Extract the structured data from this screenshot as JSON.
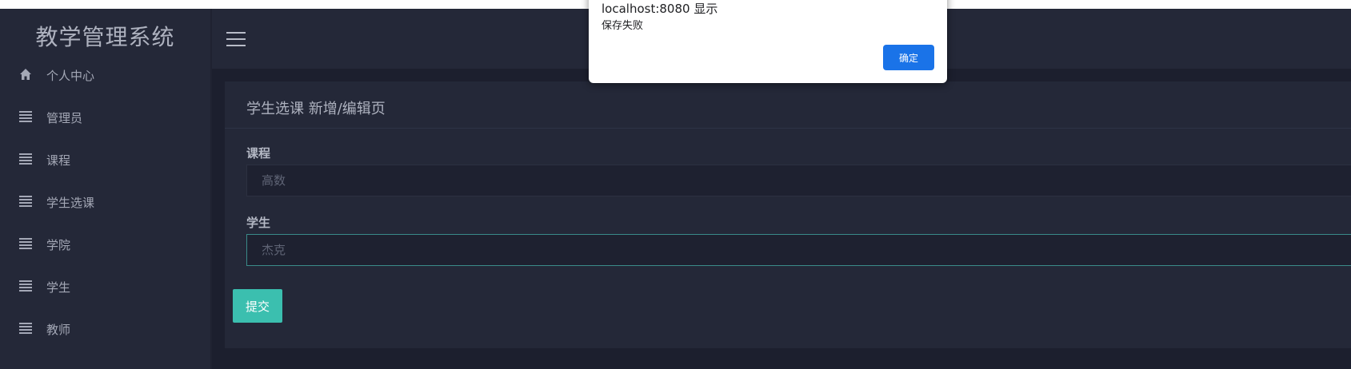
{
  "app_title": "教学管理系统",
  "menu": [
    {
      "label": "个人中心",
      "icon": "home-icon"
    },
    {
      "label": "管理员",
      "icon": "list-icon"
    },
    {
      "label": "课程",
      "icon": "list-icon"
    },
    {
      "label": "学生选课",
      "icon": "list-icon"
    },
    {
      "label": "学院",
      "icon": "list-icon"
    },
    {
      "label": "学生",
      "icon": "list-icon"
    },
    {
      "label": "教师",
      "icon": "list-icon"
    }
  ],
  "topbar": {
    "menu_icon": "hamburger-icon"
  },
  "panel": {
    "title": "学生选课 新增/编辑页",
    "fields": [
      {
        "label": "课程",
        "value": "高数"
      },
      {
        "label": "学生",
        "value": "杰克"
      }
    ],
    "submit_label": "提交"
  },
  "dialog": {
    "title": "localhost:8080 显示",
    "message": "保存失败",
    "ok_label": "确定"
  },
  "colors": {
    "sidebar_bg": "#242838",
    "page_bg": "#1c1f2e",
    "submit_bg": "#3bbfaf",
    "dialog_button": "#1a73e8"
  }
}
